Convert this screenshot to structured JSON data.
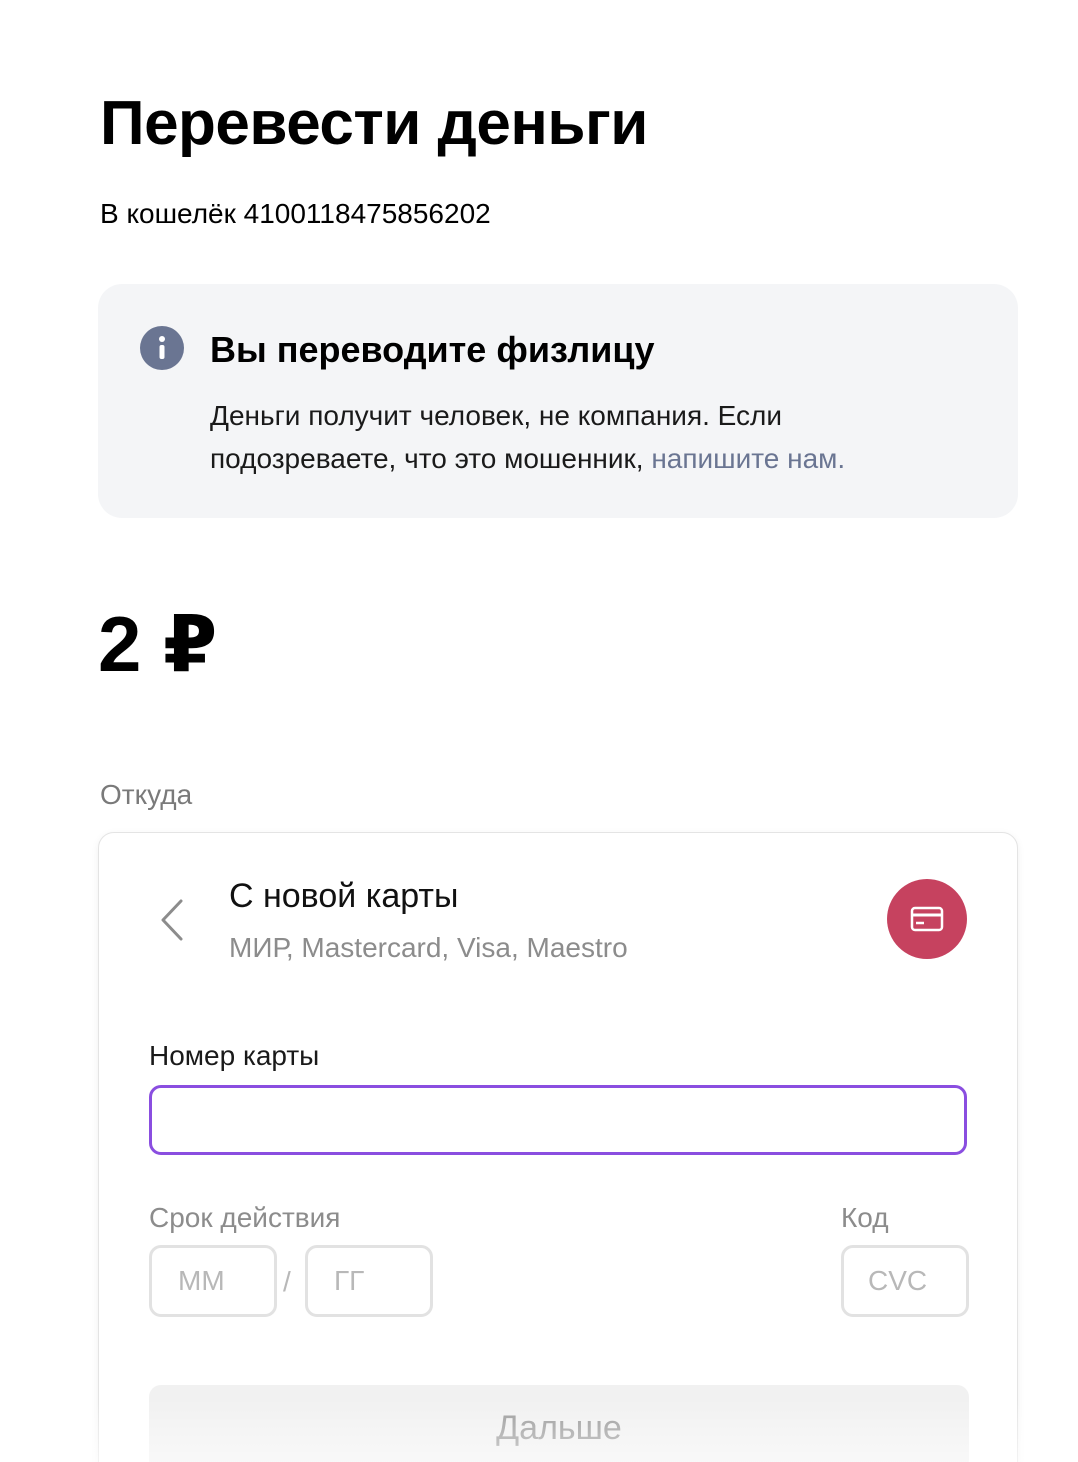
{
  "page": {
    "title": "Перевести деньги",
    "wallet_text": "В кошелёк 4100118475856202"
  },
  "notice": {
    "icon": "info-icon",
    "title": "Вы переводите физлицу",
    "text": "Деньги получит человек, не компания. Если подозреваете, что это мошенник, ",
    "link_text": "напишите нам."
  },
  "amount": {
    "value": "2 ₽"
  },
  "source": {
    "label": "Откуда",
    "back_icon": "chevron-left-icon",
    "title": "С новой карты",
    "subtitle": "МИР, Mastercard, Visa, Maestro",
    "badge_icon": "credit-card-icon",
    "badge_color": "#c6425f"
  },
  "form": {
    "card_number_label": "Номер карты",
    "card_number_value": "",
    "expiry_label": "Срок действия",
    "month_placeholder": "ММ",
    "year_placeholder": "ГГ",
    "separator": "/",
    "code_label": "Код",
    "cvc_placeholder": "CVC",
    "submit_label": "Дальше"
  },
  "colors": {
    "accent_focus": "#8a4ee0",
    "link": "#6a7592",
    "notice_bg": "#f4f5f7",
    "info_icon": "#6a7592"
  }
}
